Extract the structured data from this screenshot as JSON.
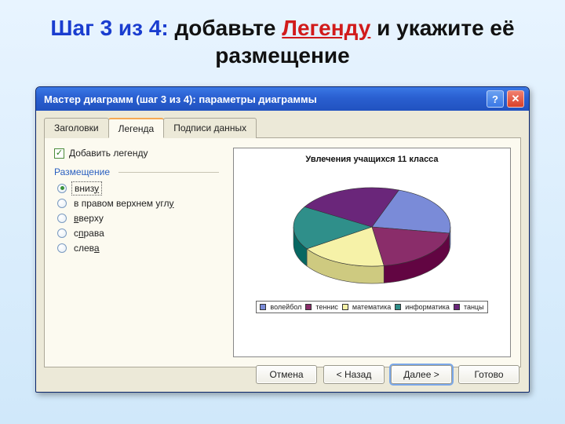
{
  "heading": {
    "step": "Шаг 3 из 4:",
    "mid1": " добавьте ",
    "legend_word": "Легенду",
    "mid2": " и укажите её размещение"
  },
  "dialog": {
    "title": "Мастер диаграмм (шаг 3 из 4): параметры диаграммы",
    "help": "?",
    "close": "✕"
  },
  "tabs": {
    "titles": [
      "Заголовки",
      "Легенда",
      "Подписи данных"
    ],
    "active_index": 1
  },
  "legend_pane": {
    "checkbox_label": "Добавить легенду",
    "checkbox_checked": true,
    "group_label": "Размещение",
    "options": [
      {
        "plain": "вниз",
        "u": "у",
        "tail": ""
      },
      {
        "plain": "в правом верхнем угл",
        "u": "у",
        "tail": ""
      },
      {
        "plain": "",
        "u": "в",
        "tail": "верху"
      },
      {
        "plain": "с",
        "u": "п",
        "tail": "рава"
      },
      {
        "plain": "слев",
        "u": "а",
        "tail": ""
      }
    ],
    "selected_index": 0
  },
  "preview": {
    "title": "Увлечения учащихся 11 класса",
    "legend_items": [
      "волейбол",
      "теннис",
      "математика",
      "информатика",
      "танцы"
    ]
  },
  "chart_data": {
    "type": "pie",
    "title": "Увлечения учащихся 11 класса",
    "categories": [
      "волейбол",
      "теннис",
      "математика",
      "информатика",
      "танцы"
    ],
    "values": [
      22,
      20,
      18,
      18,
      22
    ],
    "colors": [
      "#7a8bd8",
      "#8a2d6a",
      "#f6f2a8",
      "#2f8f8a",
      "#6a267a"
    ]
  },
  "buttons": {
    "cancel": "Отмена",
    "back": "< Назад",
    "next": "Далее >",
    "finish": "Готово"
  }
}
